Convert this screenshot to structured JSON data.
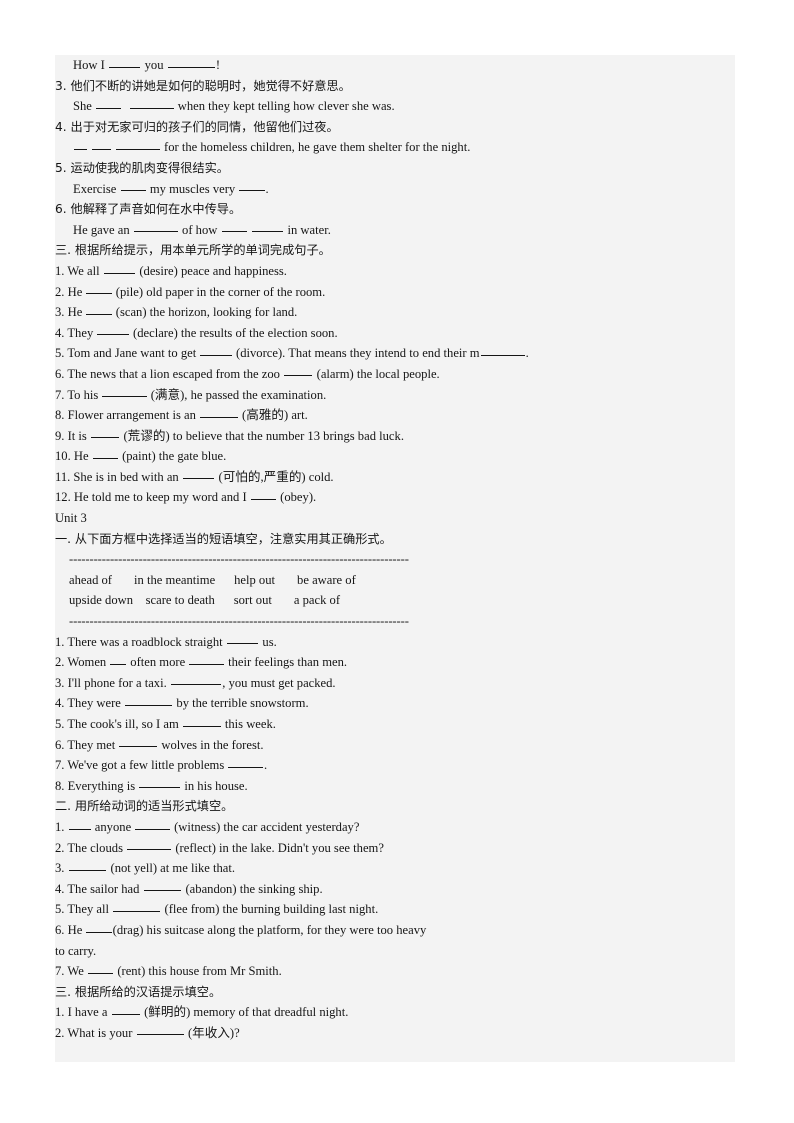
{
  "document": {
    "page_background": "#ffffff",
    "content_background": "#f3f3f3",
    "text_color": "#151515"
  },
  "lines": [
    {
      "id": "l01",
      "indent": "sub",
      "text": "How I __________ you _______________!"
    },
    {
      "id": "l02",
      "indent": "num",
      "lang": "cn",
      "text": "3. 他们不断的讲她是如何的聪明时，她觉得不好意思。"
    },
    {
      "id": "l03",
      "indent": "sub",
      "text": "She ________  ______________ when they kept telling how clever she was."
    },
    {
      "id": "l04",
      "indent": "num",
      "lang": "cn",
      "text": "4. 出于对无家可归的孩子们的同情，他留他们过夜。"
    },
    {
      "id": "l05",
      "indent": "sub",
      "text": "____ ______ ______________ for the homeless children, he gave them shelter for the night."
    },
    {
      "id": "l06",
      "indent": "num",
      "lang": "cn",
      "text": "5. 运动使我的肌肉变得很结实。"
    },
    {
      "id": "l07",
      "indent": "sub",
      "text": "Exercise ________ my muscles very ________."
    },
    {
      "id": "l08",
      "indent": "num",
      "lang": "cn",
      "text": "6. 他解释了声音如何在水中传导。"
    },
    {
      "id": "l09",
      "indent": "sub",
      "text": "He gave an ______________ of how ________ __________ in water."
    },
    {
      "id": "l10",
      "indent": "num",
      "lang": "cn",
      "text": "三. 根据所给提示，用本单元所学的单词完成句子。"
    },
    {
      "id": "l11",
      "indent": "num",
      "text": "1. We all __________ (desire) peace and happiness."
    },
    {
      "id": "l12",
      "indent": "num",
      "text": "2. He ________ (pile) old paper in the corner of the room."
    },
    {
      "id": "l13",
      "indent": "num",
      "text": "3. He ________ (scan) the horizon, looking for land."
    },
    {
      "id": "l14",
      "indent": "num",
      "text": "4. They __________ (declare) the results of the election soon."
    },
    {
      "id": "l15",
      "indent": "num",
      "text": "5. Tom and Jane want to get __________ (divorce). That means they intend to end their m______________."
    },
    {
      "id": "l16",
      "indent": "num",
      "text": "6. The news that a lion escaped from the zoo _________ (alarm) the local people."
    },
    {
      "id": "l17",
      "indent": "num",
      "text": "7. To his ______________ (满意), he passed the examination."
    },
    {
      "id": "l18",
      "indent": "num",
      "text": "8. Flower arrangement is an ____________ (高雅的) art."
    },
    {
      "id": "l19",
      "indent": "num",
      "text": "9. It is _________ (荒谬的) to believe that the number 13 brings bad luck."
    },
    {
      "id": "l20",
      "indent": "num",
      "text": "10. He ________ (paint) the gate blue."
    },
    {
      "id": "l21",
      "indent": "num",
      "text": "11. She is in bed with an __________ (可怕的,严重的) cold."
    },
    {
      "id": "l22",
      "indent": "num",
      "text": "12. He told me to keep my word and I ________ (obey)."
    },
    {
      "id": "l23",
      "indent": "num",
      "text": "Unit 3"
    },
    {
      "id": "l24",
      "indent": "num",
      "lang": "cn",
      "text": "一. 从下面方框中选择适当的短语填空，注意实用其正确形式。"
    },
    {
      "id": "l25",
      "indent": "sub2",
      "type": "rule",
      "text": "-----------------------------------------------------------------------------------"
    },
    {
      "id": "l26",
      "indent": "sub2",
      "type": "box",
      "text": "ahead of       in the meantime      help out       be aware of"
    },
    {
      "id": "l27",
      "indent": "sub2",
      "type": "box",
      "text": "upside down    scare to death      sort out       a pack of"
    },
    {
      "id": "l28",
      "indent": "sub2",
      "type": "rule",
      "text": "-----------------------------------------------------------------------------------"
    },
    {
      "id": "l29",
      "indent": "num",
      "text": "1. There was a roadblock straight __________ us."
    },
    {
      "id": "l30",
      "indent": "num",
      "text": "2. Women _____ often more ___________ their feelings than men."
    },
    {
      "id": "l31",
      "indent": "num",
      "text": "3. I'll phone for a taxi. ________________, you must get packed."
    },
    {
      "id": "l32",
      "indent": "num",
      "text": "4. They were _______________ by the terrible snowstorm."
    },
    {
      "id": "l33",
      "indent": "num",
      "text": "5. The cook's ill, so I am ____________ this week."
    },
    {
      "id": "l34",
      "indent": "num",
      "text": "6. They met ____________ wolves in the forest."
    },
    {
      "id": "l35",
      "indent": "num",
      "text": "7. We've got a few little problems ___________."
    },
    {
      "id": "l36",
      "indent": "num",
      "text": "8. Everything is _____________ in his house."
    },
    {
      "id": "l37",
      "indent": "num",
      "lang": "cn",
      "text": "二. 用所给动词的适当形式填空。"
    },
    {
      "id": "l38",
      "indent": "num",
      "text": "1. _______ anyone ___________ (witness) the car accident yesterday?"
    },
    {
      "id": "l39",
      "indent": "num",
      "text": "2. The clouds ______________ (reflect) in the lake. Didn't you see them?"
    },
    {
      "id": "l40",
      "indent": "num",
      "text": "3. ____________ (not yell) at me like that."
    },
    {
      "id": "l41",
      "indent": "num",
      "text": "4. The sailor had ____________ (abandon) the sinking ship."
    },
    {
      "id": "l42",
      "indent": "num",
      "text": "5. They all _______________ (flee from) the burning building last night."
    },
    {
      "id": "l43",
      "indent": "num",
      "text": "6. He ________(drag) his suitcase along the platform, for they were too heavy"
    },
    {
      "id": "l44",
      "indent": "num",
      "text": "to carry."
    },
    {
      "id": "l45",
      "indent": "num",
      "text": "7. We ________ (rent) this house from Mr Smith."
    },
    {
      "id": "l46",
      "indent": "num",
      "lang": "cn",
      "text": "三. 根据所给的汉语提示填空。"
    },
    {
      "id": "l47",
      "indent": "num",
      "text": "1. I have a _________ (鲜明的) memory of that dreadful night."
    },
    {
      "id": "l48",
      "indent": "num",
      "text": "2. What is your _______________ (年收入)?"
    }
  ]
}
